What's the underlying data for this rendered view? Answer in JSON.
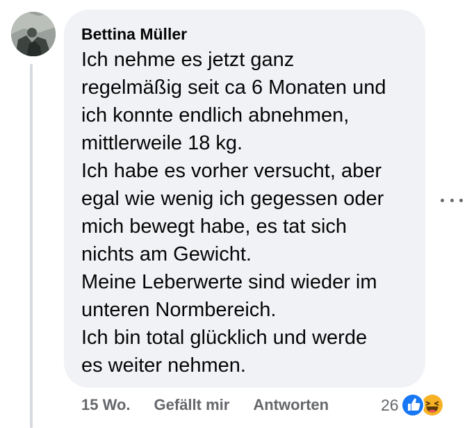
{
  "comment": {
    "author": "Bettina Müller",
    "text": "Ich nehme es jetzt ganz\nregelmäßig seit ca 6 Monaten und\nich konnte endlich abnehmen,\nmittlerweile 18 kg.\nIch habe es vorher versucht, aber\negal wie wenig ich gegessen oder\nmich bewegt habe, es tat sich\nnichts am Gewicht.\nMeine Leberwerte sind wieder im\nunteren Normbereich.\nIch bin total glücklich und werde\nes weiter nehmen."
  },
  "actions": {
    "timestamp": "15 Wo.",
    "like_label": "Gefällt mir",
    "reply_label": "Antworten"
  },
  "reactions": {
    "count": "26",
    "icons": [
      "like-icon",
      "haha-icon"
    ]
  },
  "more_options_icon": "ellipsis-icon",
  "colors": {
    "bubble": "#f0f2f5",
    "text": "#050505",
    "secondary_text": "#65676b",
    "like_blue": "#1877f2",
    "haha_yellow": "#f7b125"
  }
}
